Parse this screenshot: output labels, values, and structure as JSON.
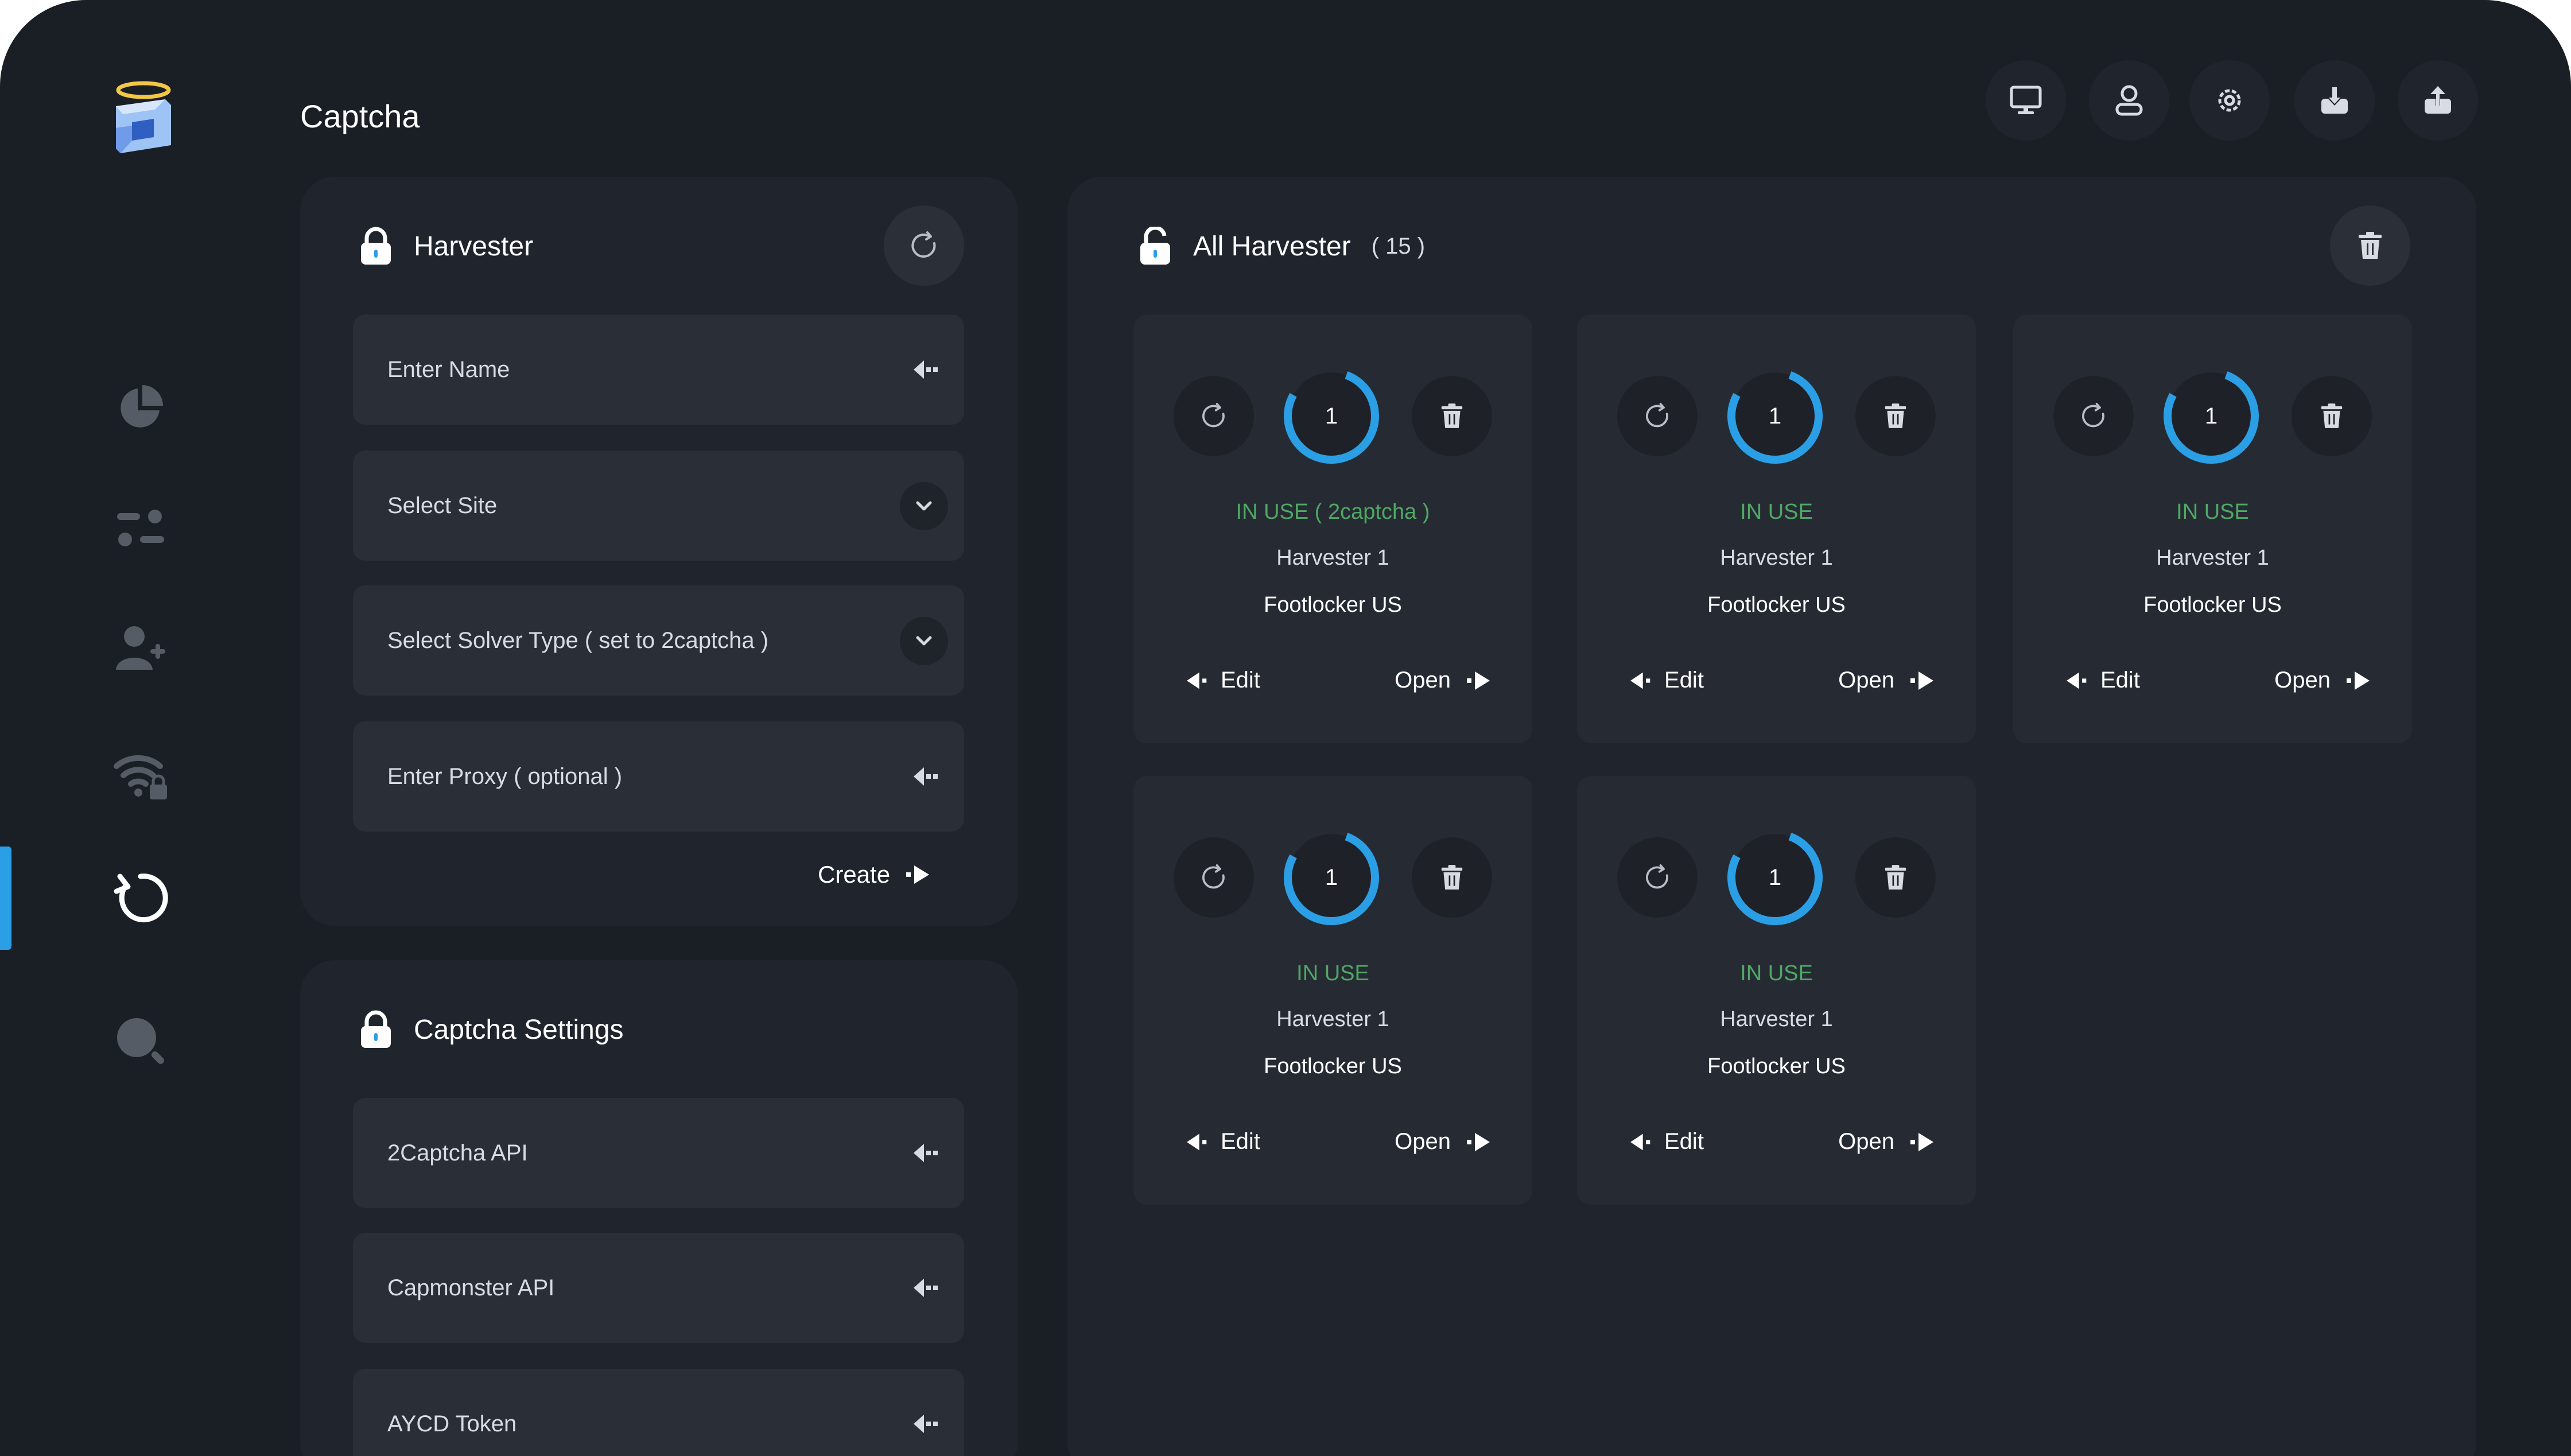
{
  "page_title": "Captcha",
  "colors": {
    "accent": "#2b9fe6",
    "status_green": "#4fa864",
    "background": "#1a1e25",
    "panel": "#20252d"
  },
  "sidebar": {
    "items": [
      {
        "icon": "pie-chart-icon"
      },
      {
        "icon": "sliders-icon"
      },
      {
        "icon": "add-user-icon"
      },
      {
        "icon": "wifi-lock-icon"
      },
      {
        "icon": "refresh-icon",
        "active": true
      },
      {
        "icon": "search-icon"
      }
    ]
  },
  "toolbar": {
    "icons": [
      "monitor-icon",
      "user-icon",
      "gear-icon",
      "download-icon",
      "upload-icon"
    ]
  },
  "harvester_form": {
    "title": "Harvester",
    "name_placeholder": "Enter Name",
    "site_placeholder": "Select Site",
    "solver_placeholder": "Select Solver Type ( set to 2captcha )",
    "proxy_placeholder": "Enter Proxy ( optional )",
    "create_label": "Create"
  },
  "captcha_settings": {
    "title": "Captcha Settings",
    "twocaptcha_placeholder": "2Captcha API",
    "capmonster_placeholder": "Capmonster API",
    "aycd_placeholder": "AYCD Token"
  },
  "all_harvester": {
    "title": "All Harvester",
    "count": "( 15 )",
    "cards": [
      {
        "count": "1",
        "status": "IN USE ( 2captcha )",
        "name": "Harvester 1",
        "site": "Footlocker US",
        "edit": "Edit",
        "open": "Open"
      },
      {
        "count": "1",
        "status": "IN USE",
        "name": "Harvester 1",
        "site": "Footlocker US",
        "edit": "Edit",
        "open": "Open"
      },
      {
        "count": "1",
        "status": "IN USE",
        "name": "Harvester 1",
        "site": "Footlocker US",
        "edit": "Edit",
        "open": "Open"
      },
      {
        "count": "1",
        "status": "IN USE",
        "name": "Harvester 1",
        "site": "Footlocker US",
        "edit": "Edit",
        "open": "Open"
      },
      {
        "count": "1",
        "status": "IN USE",
        "name": "Harvester 1",
        "site": "Footlocker US",
        "edit": "Edit",
        "open": "Open"
      }
    ]
  }
}
